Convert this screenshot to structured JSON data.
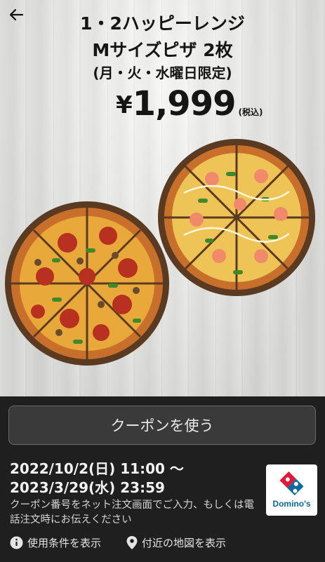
{
  "header": {
    "title_line1": "1・2ハッピーレンジ",
    "title_line2": "Mサイズピザ 2枚",
    "title_line3": "(月・火・水曜日限定)",
    "price_symbol": "¥",
    "price_amount": "1,999",
    "price_tax": "(税込)"
  },
  "actions": {
    "use_coupon": "クーポンを使う"
  },
  "validity": {
    "start": "2022/10/2(日) 11:00 ～",
    "end": "2023/3/29(水) 23:59"
  },
  "note": "クーポン番号をネット注文画面でご入力、もしくは電話注文時にお伝えください",
  "brand": {
    "name": "Domino's",
    "color_blue": "#0b6aa2",
    "color_red": "#e31837"
  },
  "footer": {
    "terms_label": "使用条件を表示",
    "map_label": "付近の地図を表示"
  },
  "icons": [
    "back-arrow-icon",
    "info-icon",
    "location-pin-icon"
  ]
}
